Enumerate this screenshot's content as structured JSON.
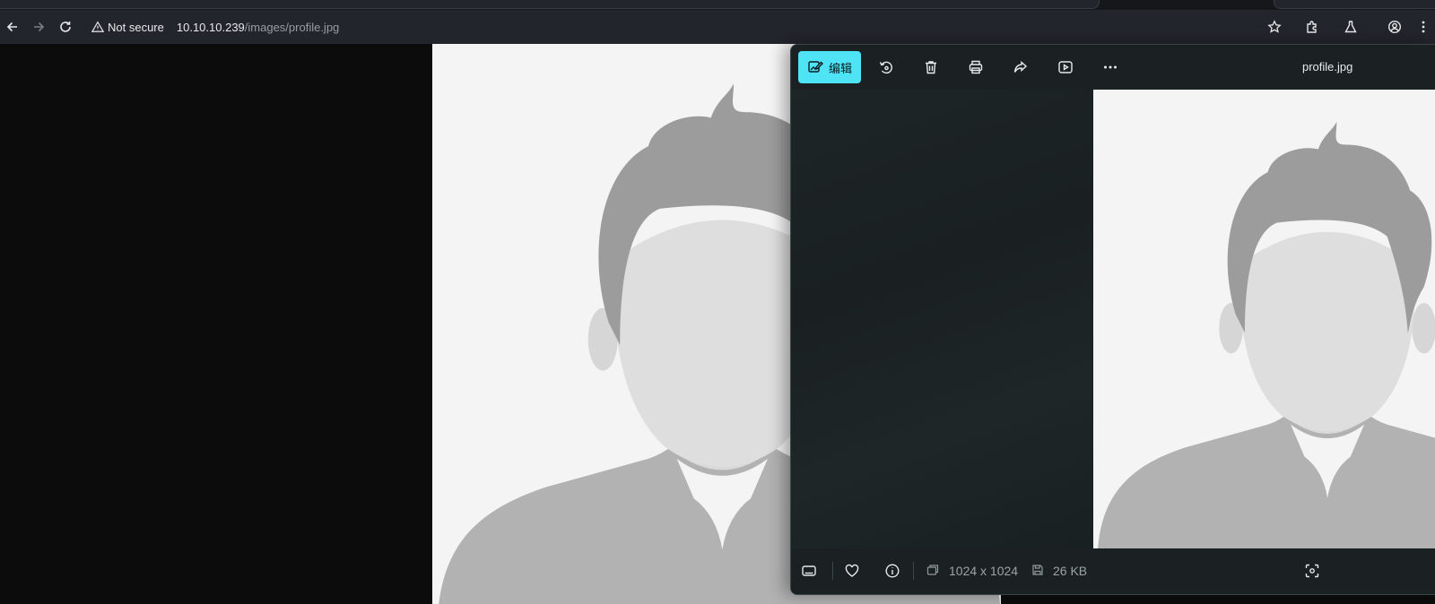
{
  "browser": {
    "security_label": "Not secure",
    "url_host": "10.10.10.239",
    "url_path": "/images/profile.jpg",
    "icons": [
      "back-icon",
      "forward-icon",
      "reload-icon",
      "warning-icon",
      "star-icon",
      "extensions-icon",
      "labs-icon",
      "profile-icon",
      "kebab-menu-icon"
    ]
  },
  "viewer": {
    "edit_label": "编辑",
    "file_name": "profile.jpg",
    "dimensions": "1024 x 1024",
    "file_size": "26 KB",
    "accent_color": "#4ee3f5",
    "toolbar_icons": [
      "edit-image-icon",
      "rotate-icon",
      "delete-icon",
      "print-icon",
      "share-icon",
      "slideshow-icon",
      "more-icon"
    ],
    "footer_icons": [
      "filmstrip-icon",
      "heart-icon",
      "info-icon",
      "image-size-icon",
      "save-size-icon",
      "fit-to-window-icon"
    ]
  }
}
